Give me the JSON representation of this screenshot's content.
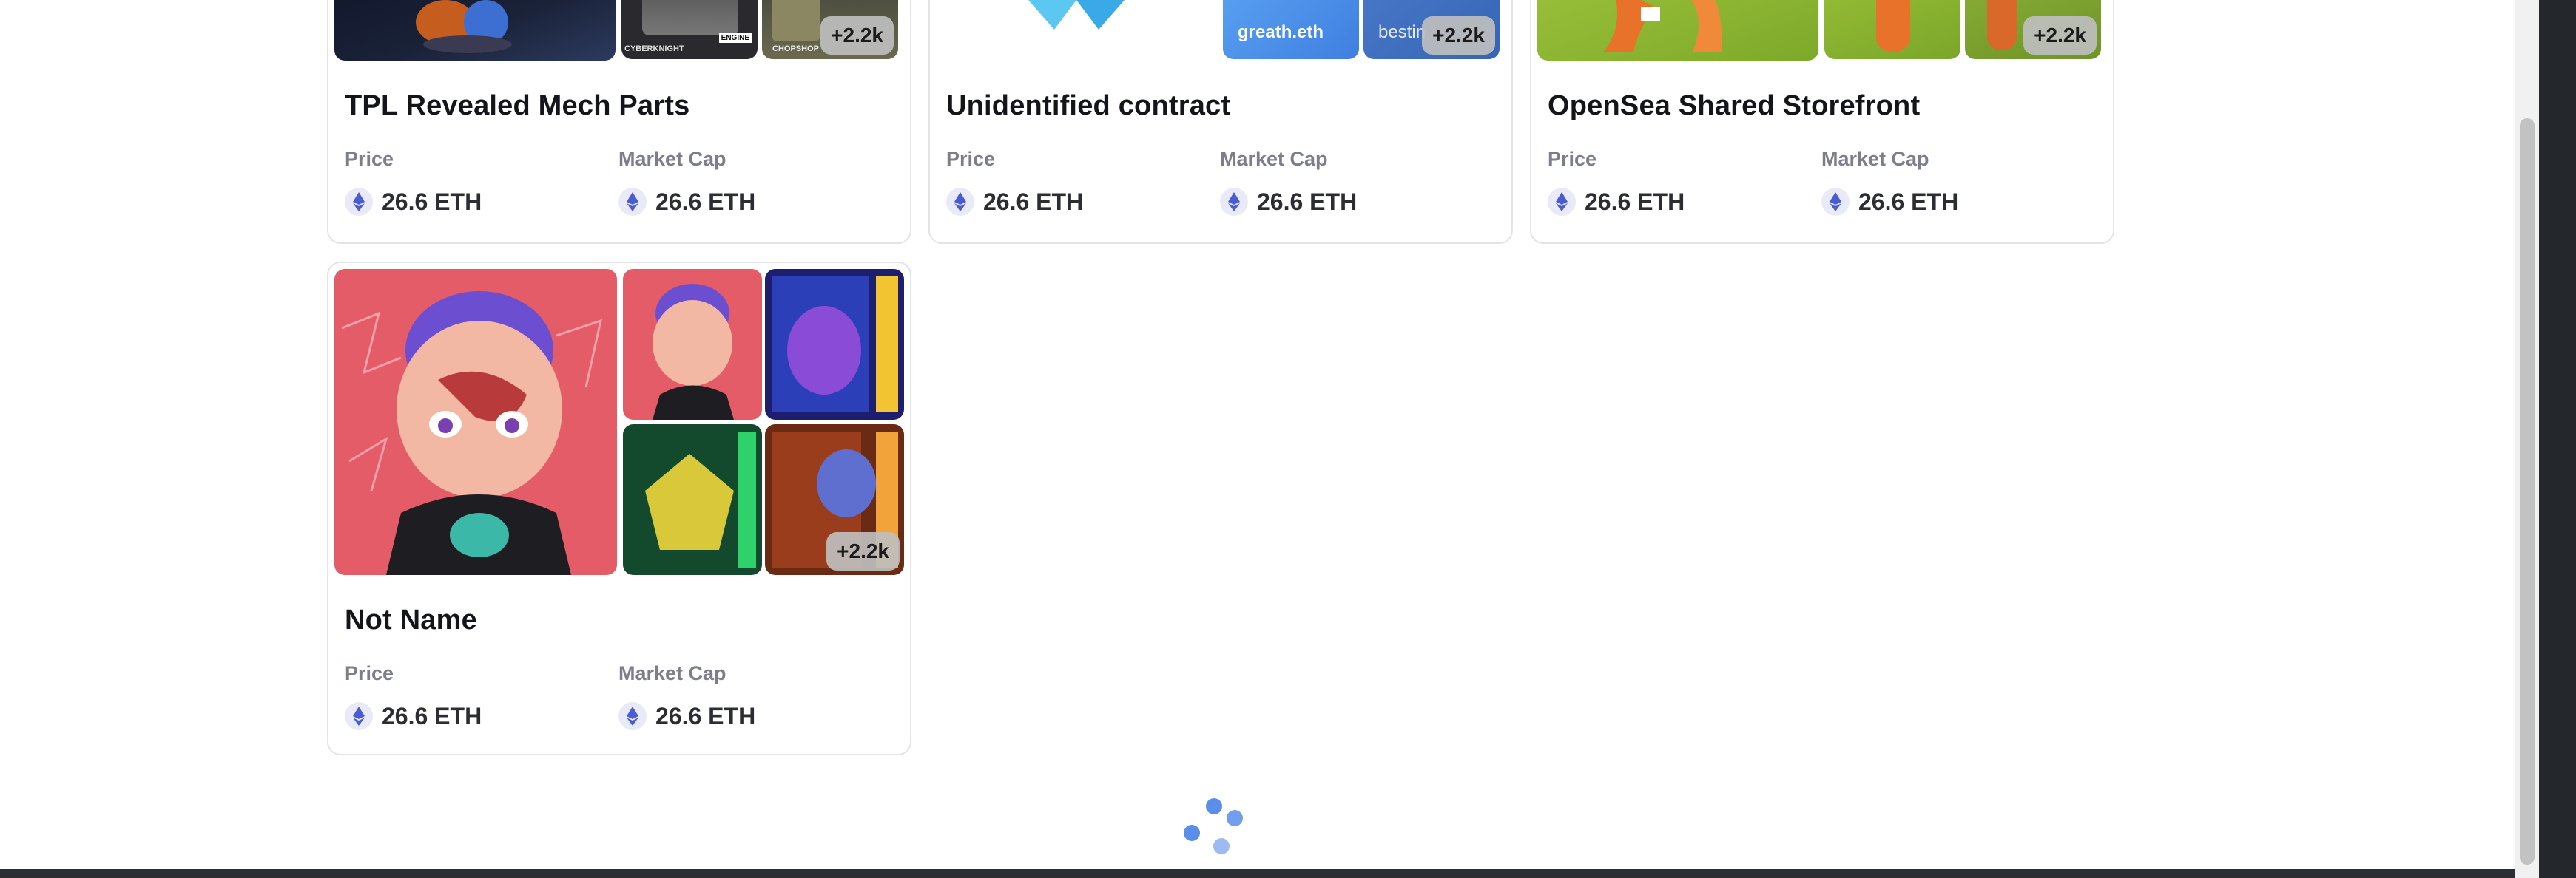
{
  "cards": [
    {
      "title": "TPL Revealed Mech Parts",
      "price_label": "Price",
      "price_value": "26.6 ETH",
      "market_cap_label": "Market Cap",
      "market_cap_value": "26.6 ETH",
      "more_count": "+2.2k",
      "thumb_captions": [
        "CYBERKNIGHT",
        "ENGINE",
        "CHOPSHOP"
      ]
    },
    {
      "title": "Unidentified contract",
      "price_label": "Price",
      "price_value": "26.6 ETH",
      "market_cap_label": "Market Cap",
      "market_cap_value": "26.6 ETH",
      "more_count": "+2.2k",
      "thumb_captions": [
        "greath.eth",
        "bestin"
      ]
    },
    {
      "title": "OpenSea Shared Storefront",
      "price_label": "Price",
      "price_value": "26.6 ETH",
      "market_cap_label": "Market Cap",
      "market_cap_value": "26.6 ETH",
      "more_count": "+2.2k"
    },
    {
      "title": "Not Name",
      "price_label": "Price",
      "price_value": "26.6 ETH",
      "market_cap_label": "Market Cap",
      "market_cap_value": "26.6 ETH",
      "more_count": "+2.2k"
    }
  ],
  "icons": {
    "currency": "ethereum-icon",
    "loading": "loading-spinner-icon"
  },
  "colors": {
    "eth_blue": "#4a5bd6",
    "spinner_blue": "#5b8dea",
    "card_border": "#e3e3e8",
    "title_text": "#14151a",
    "label_text": "#7b7f8c"
  }
}
